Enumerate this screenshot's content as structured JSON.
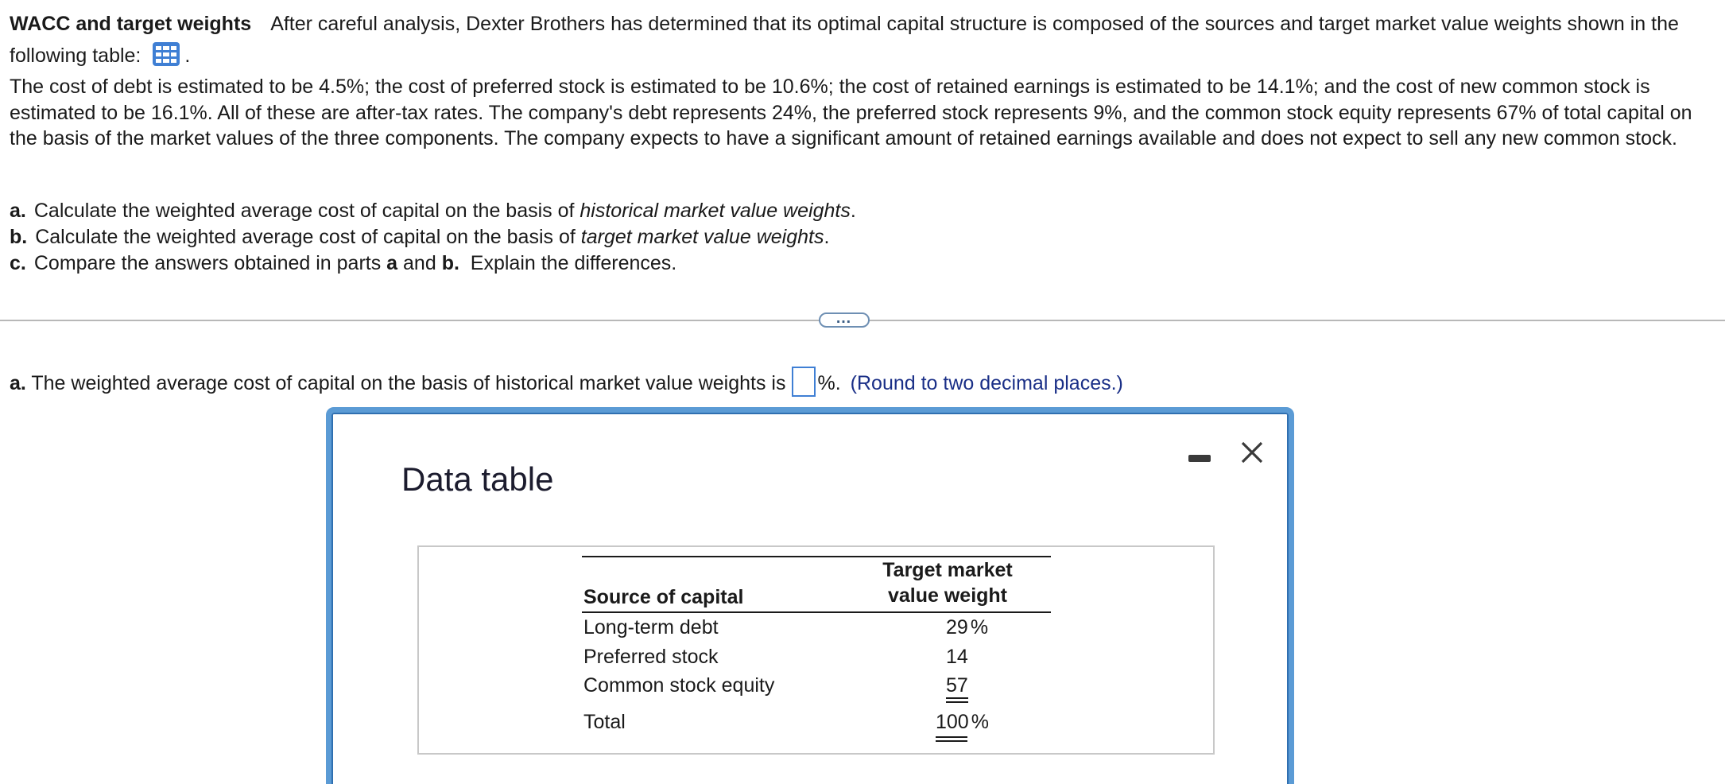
{
  "problem": {
    "title": "WACC and target weights",
    "intro": "After careful analysis, Dexter Brothers has determined that its optimal capital structure is composed of the sources and target market value weights shown in the following table:",
    "intro_end": ".",
    "table_icon": "table-grid-icon",
    "paragraph": "The cost of debt is estimated to be 4.5%; the cost of preferred stock is estimated to be 10.6%; the cost of retained earnings is estimated to be 14.1%; and the cost of new common stock is estimated to be 16.1%. All of these are after-tax rates.  The company's debt represents 24%, the preferred stock represents 9%, and the common stock equity represents 67% of total capital on the basis of the market values of the three components.  The company expects to have a significant amount of retained earnings available and does not expect to sell any new common stock.",
    "parts": [
      {
        "letter": "a.",
        "text_before": "Calculate the weighted average cost of capital on the basis of ",
        "text_italic": "historical market value weights",
        "text_after": "."
      },
      {
        "letter": "b.",
        "text_before": "Calculate the weighted average cost of capital on the basis of ",
        "text_italic": "target market value weights",
        "text_after": "."
      },
      {
        "letter": "c.",
        "text_before": "Compare the answers obtained in parts ",
        "bold_a": "a",
        "mid": " and ",
        "bold_b": "b.",
        "text_after": "  Explain the differences."
      }
    ]
  },
  "more_button": "…",
  "question": {
    "letter": "a.",
    "text": "The weighted average cost of capital on the basis of historical market value weights is",
    "answer_value": "",
    "unit": "%.",
    "hint": "(Round to two decimal places.)"
  },
  "modal": {
    "title": "Data table",
    "minimize_icon": "minimize-icon",
    "close_icon": "close-icon",
    "table": {
      "header_source": "Source of capital",
      "header_weight_line1": "Target market",
      "header_weight_line2": "value weight",
      "rows": [
        {
          "source": "Long-term debt",
          "weight": "29",
          "suffix": "%"
        },
        {
          "source": "Preferred stock",
          "weight": "14",
          "suffix": ""
        },
        {
          "source": "Common stock equity",
          "weight": "57",
          "suffix": ""
        },
        {
          "source": "Total",
          "weight": "100",
          "suffix": "%"
        }
      ]
    }
  }
}
